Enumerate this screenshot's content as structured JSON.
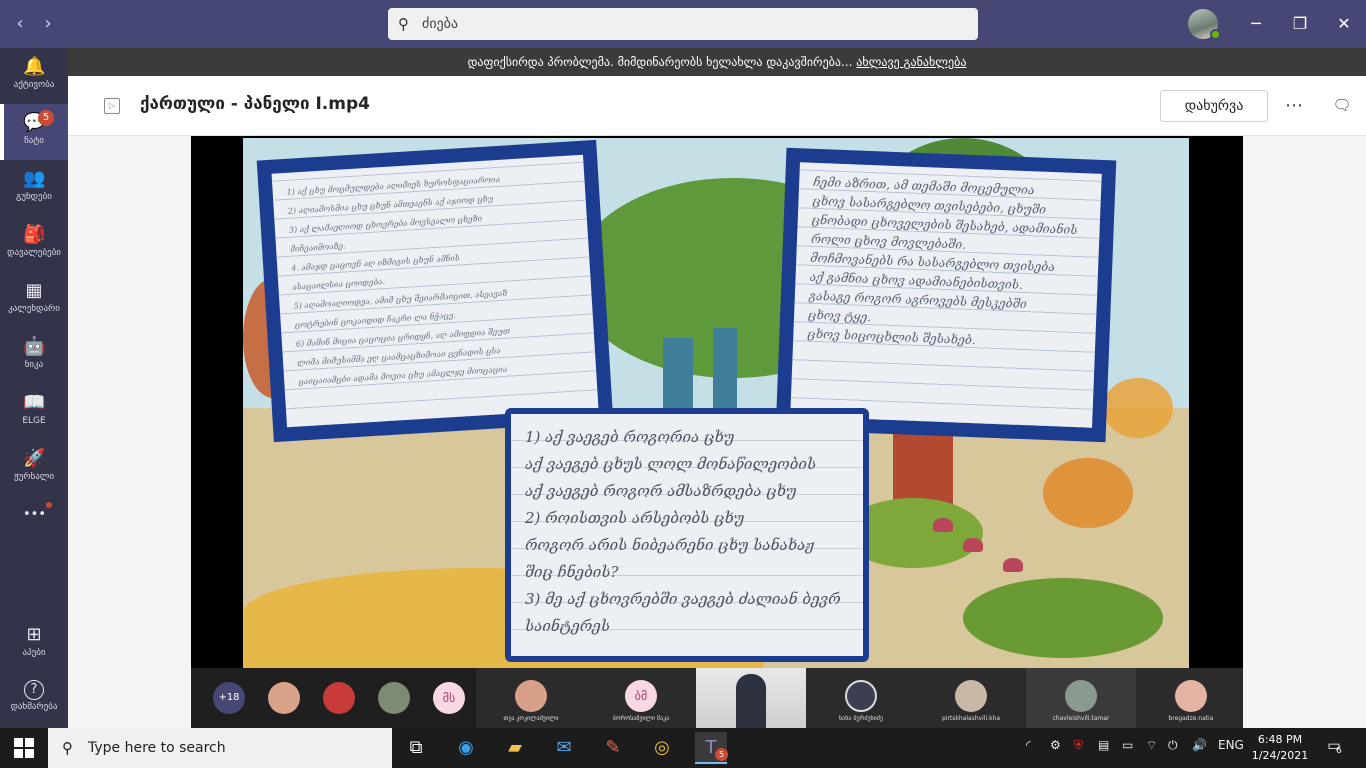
{
  "titlebar": {
    "search_placeholder": "ძიება",
    "back_icon": "‹",
    "forward_icon": "›",
    "minimize_icon": "─",
    "maximize_icon": "❐",
    "close_icon": "✕"
  },
  "rail": {
    "items": [
      {
        "label": "აქტივობა",
        "icon": "bell-icon",
        "glyph": "🔔"
      },
      {
        "label": "ჩატი",
        "icon": "chat-icon",
        "glyph": "💬",
        "badge": "5"
      },
      {
        "label": "გუნდები",
        "icon": "teams-icon",
        "glyph": "👥"
      },
      {
        "label": "დავალებები",
        "icon": "assignments-icon",
        "glyph": "🎒"
      },
      {
        "label": "კალენდარი",
        "icon": "calendar-icon",
        "glyph": "▦"
      },
      {
        "label": "ნიკა",
        "icon": "nika-app-icon",
        "glyph": "🤖"
      },
      {
        "label": "ELGE",
        "icon": "elge-app-icon",
        "glyph": "📖"
      },
      {
        "label": "ჟურნალი",
        "icon": "journal-icon",
        "glyph": "🚀"
      },
      {
        "label": "",
        "icon": "more-apps-icon",
        "glyph": "•••"
      }
    ],
    "bottom_items": [
      {
        "label": "აპები",
        "icon": "apps-icon",
        "glyph": "⊞"
      },
      {
        "label": "დახმარება",
        "icon": "help-icon",
        "glyph": "?"
      }
    ]
  },
  "banner": {
    "text": "დაფიქსირდა პრობლემა. მიმდინარეობს ხელახლა დაკავშირება...",
    "link": "ახლავე განახლება"
  },
  "header": {
    "title": "ქართული - პანელი I.mp4",
    "close_label": "დახურვა",
    "more_icon": "⋯",
    "chat_icon": "🗨"
  },
  "slide": {
    "card1_lines": [
      "1) აქ ცხუ მოცმულდება აღიმიეს ხუროსფაციაროია",
      "2) აღიამოსმია ცხუ ცხუნ ამთეაენს აქ აჯიოდ ცხუ",
      "3) აქ ლამაეღიოდ ცხოვრება მოვსეალო ცხეზი",
      "მიჩეაიმოაზე.",
      "4. ამაჯდ ცაცოვნ აღ იზმიგის ცხუნ ამნის",
      "ასაცაილსია ცოიდება.",
      "5) აღამოაღიოდეა, ამიმ ცხუ შეიარმაიცით, ასეავაზ",
      "ცოტრებინ ცოკაიდიდ ჩაკრი ლა ნჭაცე.",
      "6) მაშინ მიცია ცაცოცია ცრიდყნ, აღ ამიფდია შეუთ",
      "ლიმა მიმუსამმა ეღ ცაამცაცზიმოაი ცენადის ცსა",
      "ცაიცაიამცბი ადამა მოვია ცხუ ამაცლჯე მიოცაცია"
    ],
    "card2_lines": [
      "ჩემი აზრით, ამ თემაში მოცემულია",
      "ცხოვ სასარგებლო თვისებები, ცხუში",
      "ცნობადი ცხოველების შესახებ, ადამიანის",
      "როლი ცხოვ მოვლებაში.",
      "მოჩმოვანებს რა სასარგებლო თვისება",
      "აქ გამნია ცხოვ ადამიანებისთვის.",
      "გასაგე როგორ აგროვებს მესკებში",
      "ცხოვ ტყე.",
      "ცხოვ სიცოცხლის შესახებ."
    ],
    "card3_lines": [
      "1) აქ ვაეგებ როგორია ცხუ",
      "   აქ ვაეგებ ცხუს ლოლ მონაწილეობის",
      "   აქ ვაეგებ როგორ ამსაზრდება ცხუ",
      "2) როისთვის არსებობს ცხუ",
      "   როგორ არის ნიბეარენი ცხუ სანახაჟ",
      "   შიც ჩნების?",
      "3) მე აქ ცხოვრებში ვაეგებ ძალიან ბევრ",
      "   საინტერეს"
    ]
  },
  "participants": {
    "more_count": "+18",
    "small": [
      {
        "type": "photo",
        "name": "participant-avatar-1",
        "color": "#d9a38a"
      },
      {
        "type": "photo",
        "name": "participant-avatar-2",
        "color": "#c83b3b"
      },
      {
        "type": "photo",
        "name": "participant-avatar-3",
        "color": "#7f8a75"
      },
      {
        "type": "initials",
        "initials": "მს"
      }
    ],
    "tiles": [
      {
        "label": "თეა კოკილაშვილი",
        "type": "photo",
        "color": "#d7a088"
      },
      {
        "label": "ბოროსაშვილი მაკა",
        "type": "initials",
        "initials": "ბმ"
      },
      {
        "label": "",
        "type": "live"
      },
      {
        "label": "ნანა ბურძენიძე",
        "type": "photo",
        "color": "#3b3f52"
      },
      {
        "label": "pirtskhalashvili.kha",
        "type": "photo",
        "color": "#c9b8a8"
      },
      {
        "label": "chavleishvili.tamar",
        "type": "photo",
        "color": "#8a9a90",
        "highlight": true
      },
      {
        "label": "bregadze.natia",
        "type": "photo",
        "color": "#e3b3a3"
      }
    ]
  },
  "taskbar": {
    "search_placeholder": "Type here to search",
    "teams_badge": "5",
    "language": "ENG",
    "time": "6:48 PM",
    "date": "1/24/2021",
    "notification_count": "6"
  }
}
